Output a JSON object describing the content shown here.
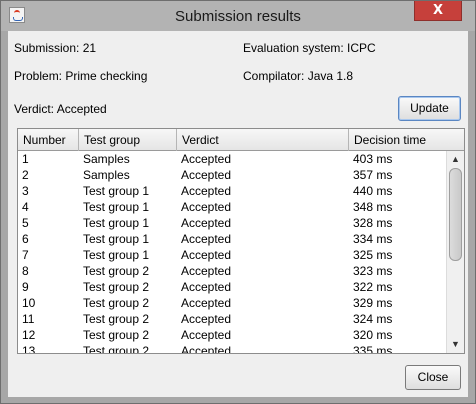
{
  "window": {
    "title": "Submission results",
    "close_glyph": "X",
    "app_icon": "java-cup-icon"
  },
  "info": {
    "submission": "Submission: 21",
    "evaluation_system": "Evaluation system: ICPC",
    "problem": "Problem: Prime checking",
    "compilator": "Compilator: Java 1.8",
    "verdict": "Verdict: Accepted"
  },
  "buttons": {
    "update": "Update",
    "close": "Close"
  },
  "table": {
    "columns": [
      "Number",
      "Test group",
      "Verdict",
      "Decision time"
    ],
    "rows": [
      [
        "1",
        "Samples",
        "Accepted",
        "403 ms"
      ],
      [
        "2",
        "Samples",
        "Accepted",
        "357 ms"
      ],
      [
        "3",
        "Test group 1",
        "Accepted",
        "440 ms"
      ],
      [
        "4",
        "Test group 1",
        "Accepted",
        "348 ms"
      ],
      [
        "5",
        "Test group 1",
        "Accepted",
        "328 ms"
      ],
      [
        "6",
        "Test group 1",
        "Accepted",
        "334 ms"
      ],
      [
        "7",
        "Test group 1",
        "Accepted",
        "325 ms"
      ],
      [
        "8",
        "Test group 2",
        "Accepted",
        "323 ms"
      ],
      [
        "9",
        "Test group 2",
        "Accepted",
        "322 ms"
      ],
      [
        "10",
        "Test group 2",
        "Accepted",
        "329 ms"
      ],
      [
        "11",
        "Test group 2",
        "Accepted",
        "324 ms"
      ],
      [
        "12",
        "Test group 2",
        "Accepted",
        "320 ms"
      ],
      [
        "13",
        "Test group 2",
        "Accepted",
        "335 ms"
      ]
    ]
  },
  "scrollbar": {
    "up_glyph": "▲",
    "down_glyph": "▼"
  }
}
